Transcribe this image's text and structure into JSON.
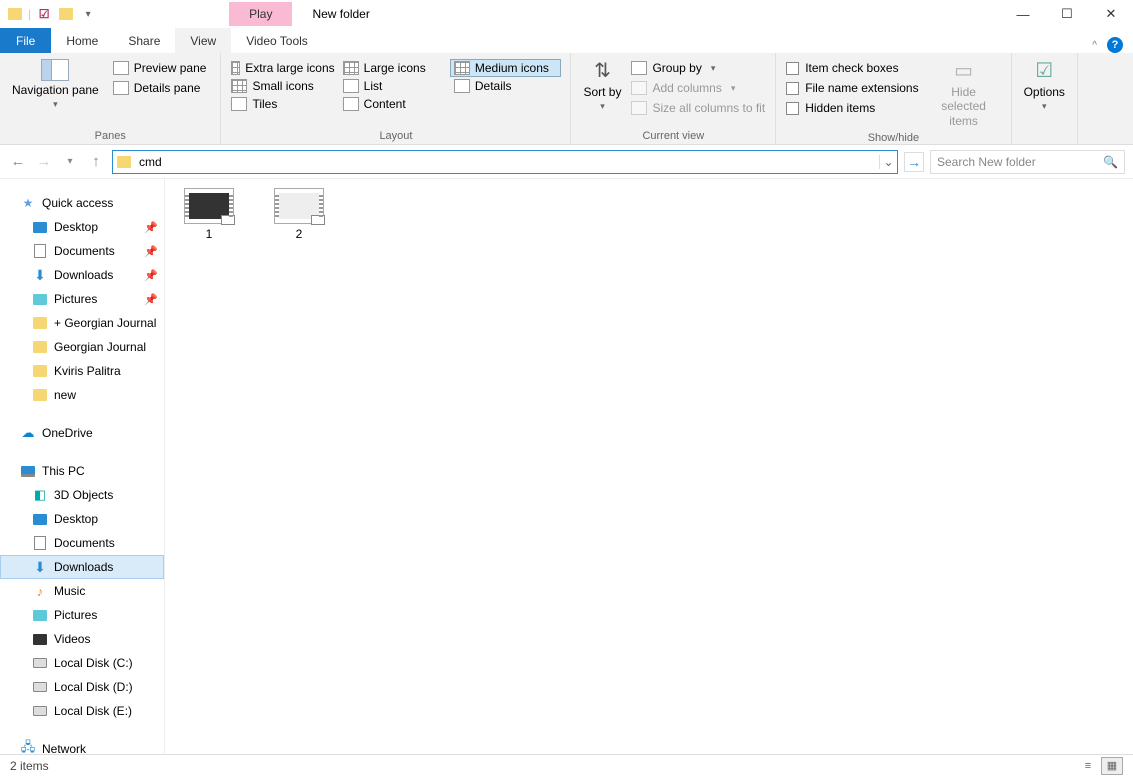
{
  "title_bar": {
    "context_tab": "Play",
    "window_title": "New folder",
    "ribbon_collapse_glyph": "^"
  },
  "tabs": {
    "file": "File",
    "home": "Home",
    "share": "Share",
    "view": "View",
    "video_tools": "Video Tools"
  },
  "ribbon": {
    "panes": {
      "navigation_pane": "Navigation pane",
      "preview_pane": "Preview pane",
      "details_pane": "Details pane",
      "label": "Panes"
    },
    "layout": {
      "extra_large_icons": "Extra large icons",
      "large_icons": "Large icons",
      "medium_icons": "Medium icons",
      "small_icons": "Small icons",
      "list": "List",
      "details": "Details",
      "tiles": "Tiles",
      "content": "Content",
      "label": "Layout"
    },
    "current_view": {
      "sort_by": "Sort by",
      "group_by": "Group by",
      "add_columns": "Add columns",
      "size_all": "Size all columns to fit",
      "label": "Current view"
    },
    "show_hide": {
      "item_check_boxes": "Item check boxes",
      "file_name_extensions": "File name extensions",
      "hidden_items": "Hidden items",
      "hide_selected": "Hide selected items",
      "label": "Show/hide"
    },
    "options": "Options"
  },
  "address": {
    "value": "cmd",
    "search_placeholder": "Search New folder"
  },
  "sidebar": {
    "quick_access": "Quick access",
    "desktop": "Desktop",
    "documents": "Documents",
    "downloads": "Downloads",
    "pictures": "Pictures",
    "georgian_plus": "+ Georgian Journal",
    "georgian": "Georgian Journal",
    "kviris": "Kviris Palitra",
    "new": "new",
    "onedrive": "OneDrive",
    "this_pc": "This PC",
    "objects_3d": "3D Objects",
    "desktop2": "Desktop",
    "documents2": "Documents",
    "downloads2": "Downloads",
    "music": "Music",
    "pictures2": "Pictures",
    "videos": "Videos",
    "disk_c": "Local Disk (C:)",
    "disk_d": "Local Disk (D:)",
    "disk_e": "Local Disk (E:)",
    "network": "Network"
  },
  "files": {
    "item1": "1",
    "item2": "2"
  },
  "status": {
    "count": "2 items"
  }
}
